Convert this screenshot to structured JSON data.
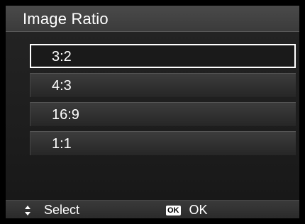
{
  "title": "Image Ratio",
  "options": [
    {
      "label": "3:2",
      "selected": true
    },
    {
      "label": "4:3",
      "selected": false
    },
    {
      "label": "16:9",
      "selected": false
    },
    {
      "label": "1:1",
      "selected": false
    }
  ],
  "footer": {
    "select_icon": "up-down-arrows-icon",
    "select_label": "Select",
    "ok_key_icon": "OK",
    "ok_label": "OK"
  },
  "colors": {
    "title_bar": "#3b3b3b",
    "selection_border": "#ffffff",
    "text": "#ffffff"
  }
}
